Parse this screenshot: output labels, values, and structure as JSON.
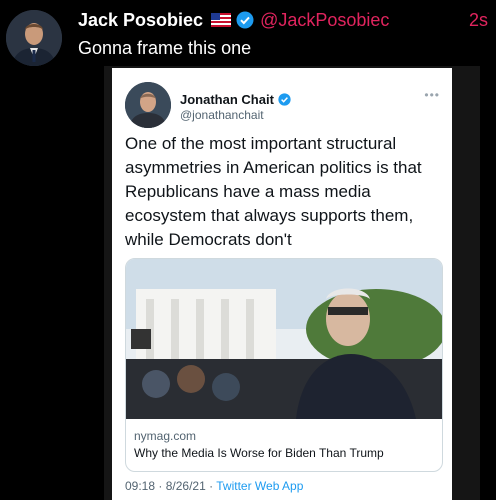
{
  "tweet": {
    "author_name": "Jack Posobiec",
    "author_handle": "@JackPosobiec",
    "time_ago": "2s",
    "text": "Gonna frame this one",
    "flag_icon": "us-flag-icon",
    "verified_icon": "verified-badge-icon"
  },
  "embedded_tweet": {
    "author_name": "Jonathan Chait",
    "author_handle": "@jonathanchait",
    "more_icon": "more-dots-icon",
    "text": "One of the most important structural asymmetries in American politics is that Republicans have a mass media ecosystem that always supports them, while Democrats don't",
    "link_card": {
      "domain": "nymag.com",
      "title": "Why the Media Is Worse for Biden Than Trump"
    },
    "time": "09:18",
    "date": "8/26/21",
    "separator": "·",
    "source": "Twitter Web App"
  },
  "colors": {
    "background": "#000000",
    "accent_pink": "#e0245e",
    "verified_blue": "#1d9bf0",
    "card_background": "#ffffff",
    "secondary_text": "#536471"
  }
}
